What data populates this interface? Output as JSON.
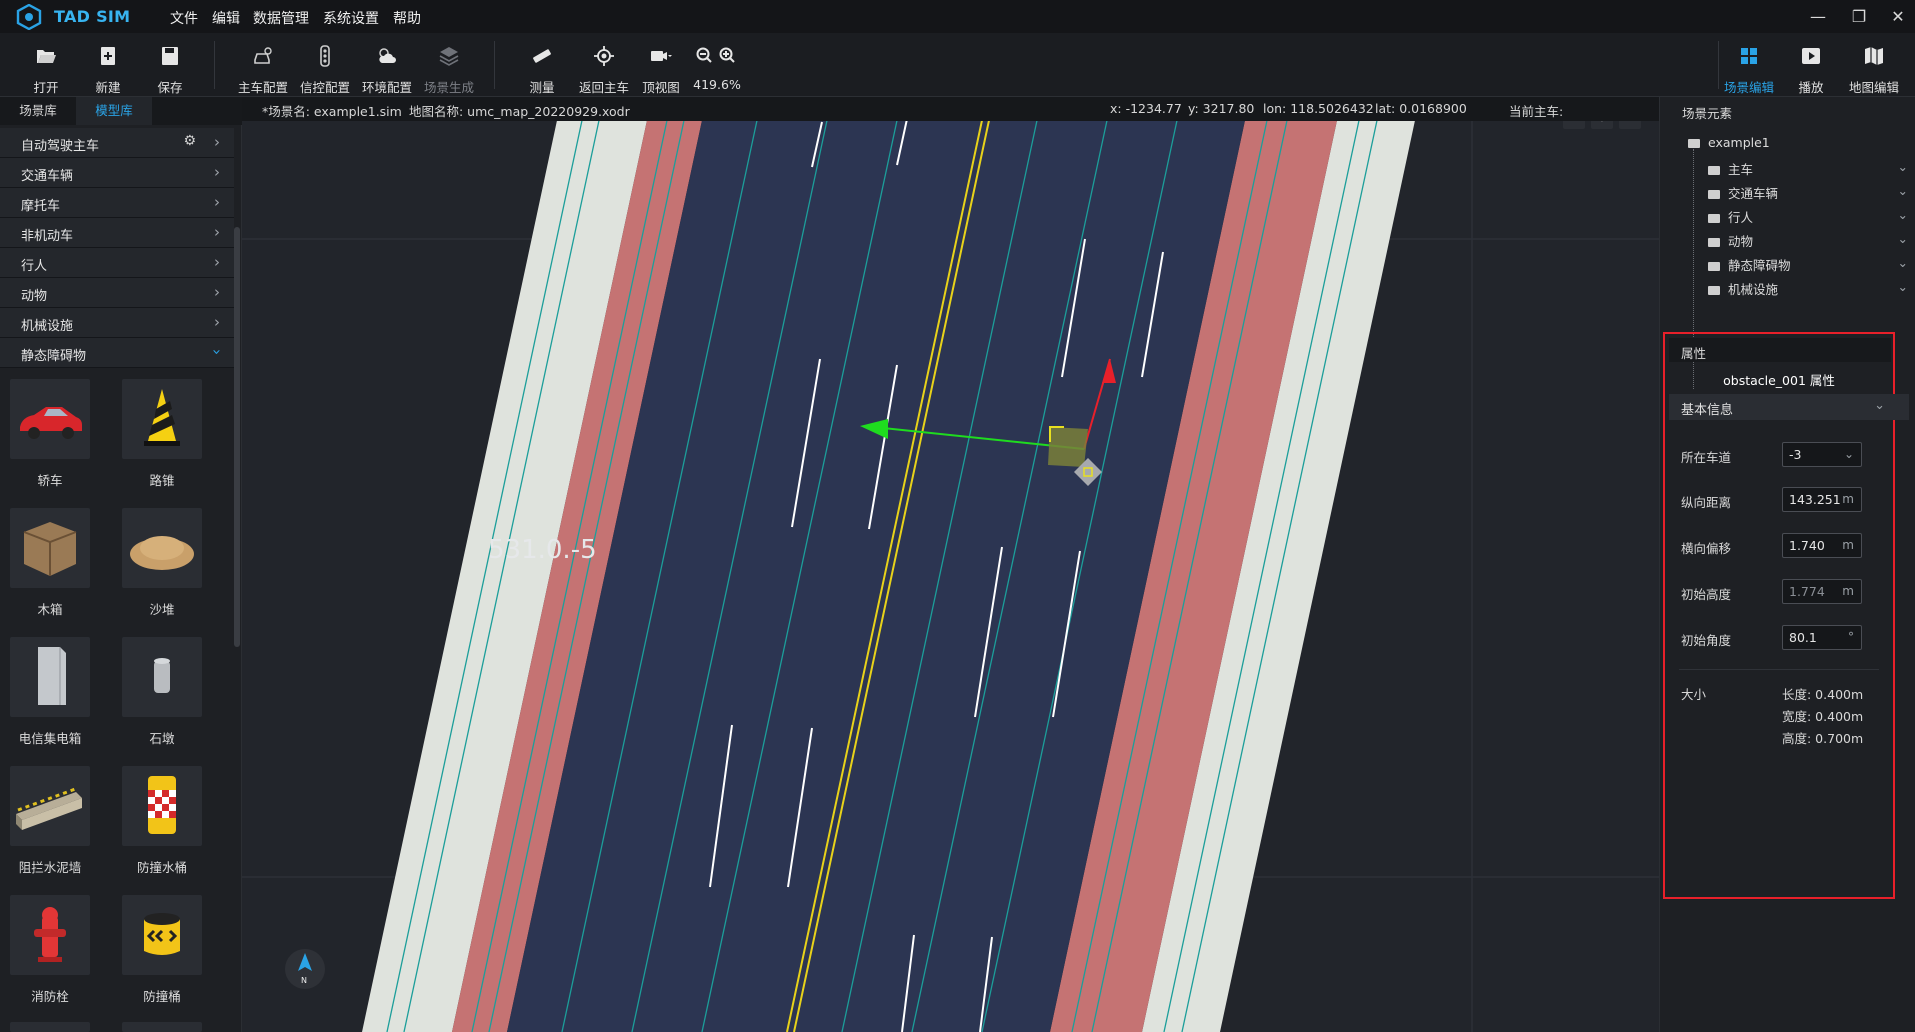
{
  "app": {
    "title": "TAD SIM"
  },
  "menu": [
    "文件",
    "编辑",
    "数据管理",
    "系统设置",
    "帮助"
  ],
  "toolbar": {
    "open": "打开",
    "new": "新建",
    "save": "保存",
    "ego_config": "主车配置",
    "signal_config": "信控配置",
    "env_config": "环境配置",
    "scene_gen": "场景生成",
    "measure": "测量",
    "return_ego": "返回主车",
    "top_view": "顶视图",
    "zoom": "419.6%",
    "scene_edit": "场景编辑",
    "play": "播放",
    "map_edit": "地图编辑"
  },
  "left": {
    "tabs": [
      "场景库",
      "模型库"
    ],
    "categories": [
      "自动驾驶主车",
      "交通车辆",
      "摩托车",
      "非机动车",
      "行人",
      "动物",
      "机械设施",
      "静态障碍物"
    ],
    "models": [
      "轿车",
      "路锥",
      "木箱",
      "沙堆",
      "电信集电箱",
      "石墩",
      "阻拦水泥墙",
      "防撞水桶",
      "消防栓",
      "防撞桶"
    ]
  },
  "info": {
    "scene": "*场景名: example1.sim",
    "map": "地图名称: umc_map_20220929.xodr",
    "x": "x: -1234.77",
    "y": "y: 3217.80",
    "lon": "lon: 118.5026432",
    "lat": "lat: 0.0168900",
    "ego": "当前主车:"
  },
  "viewport": {
    "road_label": "531.0.-5",
    "compass": "N"
  },
  "scene_tree": {
    "title": "场景元素",
    "root": "example1",
    "items": [
      "主车",
      "交通车辆",
      "行人",
      "动物",
      "静态障碍物",
      "机械设施"
    ]
  },
  "props": {
    "header": "属性",
    "title": "obstacle_001 属性",
    "section": "基本信息",
    "lane_label": "所在车道",
    "lane": "-3",
    "lon_label": "纵向距离",
    "lon": "143.251",
    "lon_unit": "m",
    "lat_label": "横向偏移",
    "lat": "1.740",
    "lat_unit": "m",
    "h_label": "初始高度",
    "h": "1.774",
    "h_unit": "m",
    "ang_label": "初始角度",
    "ang": "80.1",
    "ang_unit": "°",
    "size_label": "大小",
    "length": "长度: 0.400m",
    "width": "宽度: 0.400m",
    "height": "高度: 0.700m"
  },
  "colors": {
    "accent": "#2aa3e6",
    "highlight": "#e8202a",
    "road": "#2c3552",
    "bike_lane": "#c57373",
    "sidewalk": "#dfe3dd"
  }
}
